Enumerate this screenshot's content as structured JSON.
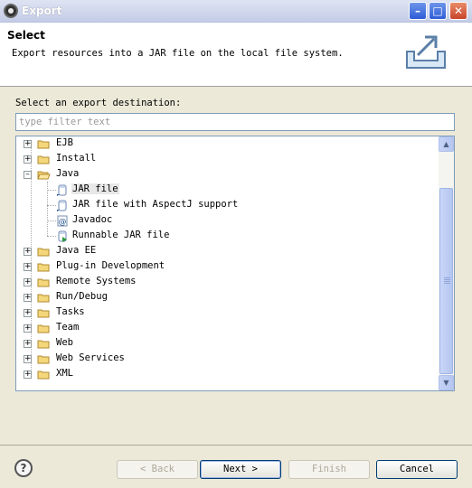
{
  "window": {
    "title": "Export"
  },
  "header": {
    "title": "Select",
    "description": "Export resources into a JAR file on the local file system."
  },
  "filter": {
    "label": "Select an export destination:",
    "placeholder": "type filter text"
  },
  "tree": {
    "items": [
      {
        "label": "EJB",
        "expanded": false
      },
      {
        "label": "Install",
        "expanded": false
      },
      {
        "label": "Java",
        "expanded": true
      },
      {
        "label": "JAR file",
        "selected": true
      },
      {
        "label": "JAR file with AspectJ support"
      },
      {
        "label": "Javadoc"
      },
      {
        "label": "Runnable JAR file"
      },
      {
        "label": "Java EE",
        "expanded": false
      },
      {
        "label": "Plug-in Development",
        "expanded": false
      },
      {
        "label": "Remote Systems",
        "expanded": false
      },
      {
        "label": "Run/Debug",
        "expanded": false
      },
      {
        "label": "Tasks",
        "expanded": false
      },
      {
        "label": "Team",
        "expanded": false
      },
      {
        "label": "Web",
        "expanded": false
      },
      {
        "label": "Web Services",
        "expanded": false
      },
      {
        "label": "XML",
        "expanded": false
      }
    ]
  },
  "buttons": {
    "back": "< Back",
    "next": "Next >",
    "finish": "Finish",
    "cancel": "Cancel",
    "help": "?"
  },
  "colors": {
    "title_bar": "#c3cce6",
    "accent": "#2d5cd6",
    "folder": "#f5d77b"
  }
}
